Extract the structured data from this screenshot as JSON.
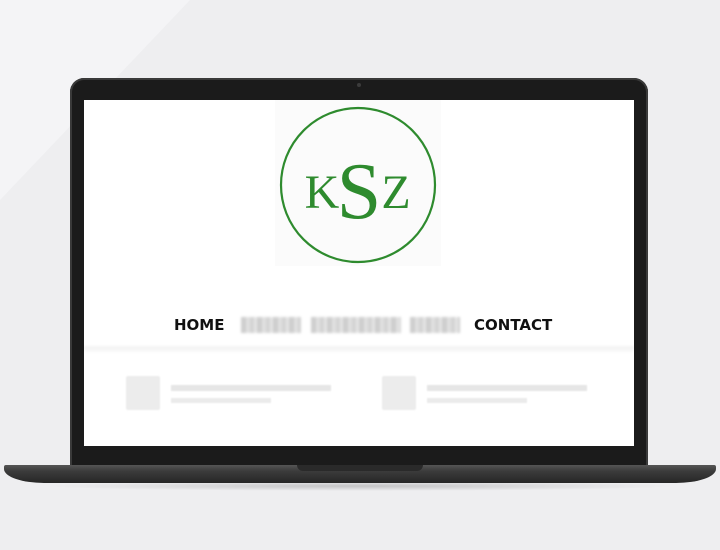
{
  "logo": {
    "letters": [
      "K",
      "S",
      "Z"
    ],
    "color": "#2e8b2e"
  },
  "nav": {
    "home_label": "HOME",
    "contact_label": "CONTACT"
  },
  "colors": {
    "background": "#eeeef0",
    "laptop_frame": "#1b1b1b",
    "screen": "#ffffff",
    "nav_text": "#111111"
  }
}
